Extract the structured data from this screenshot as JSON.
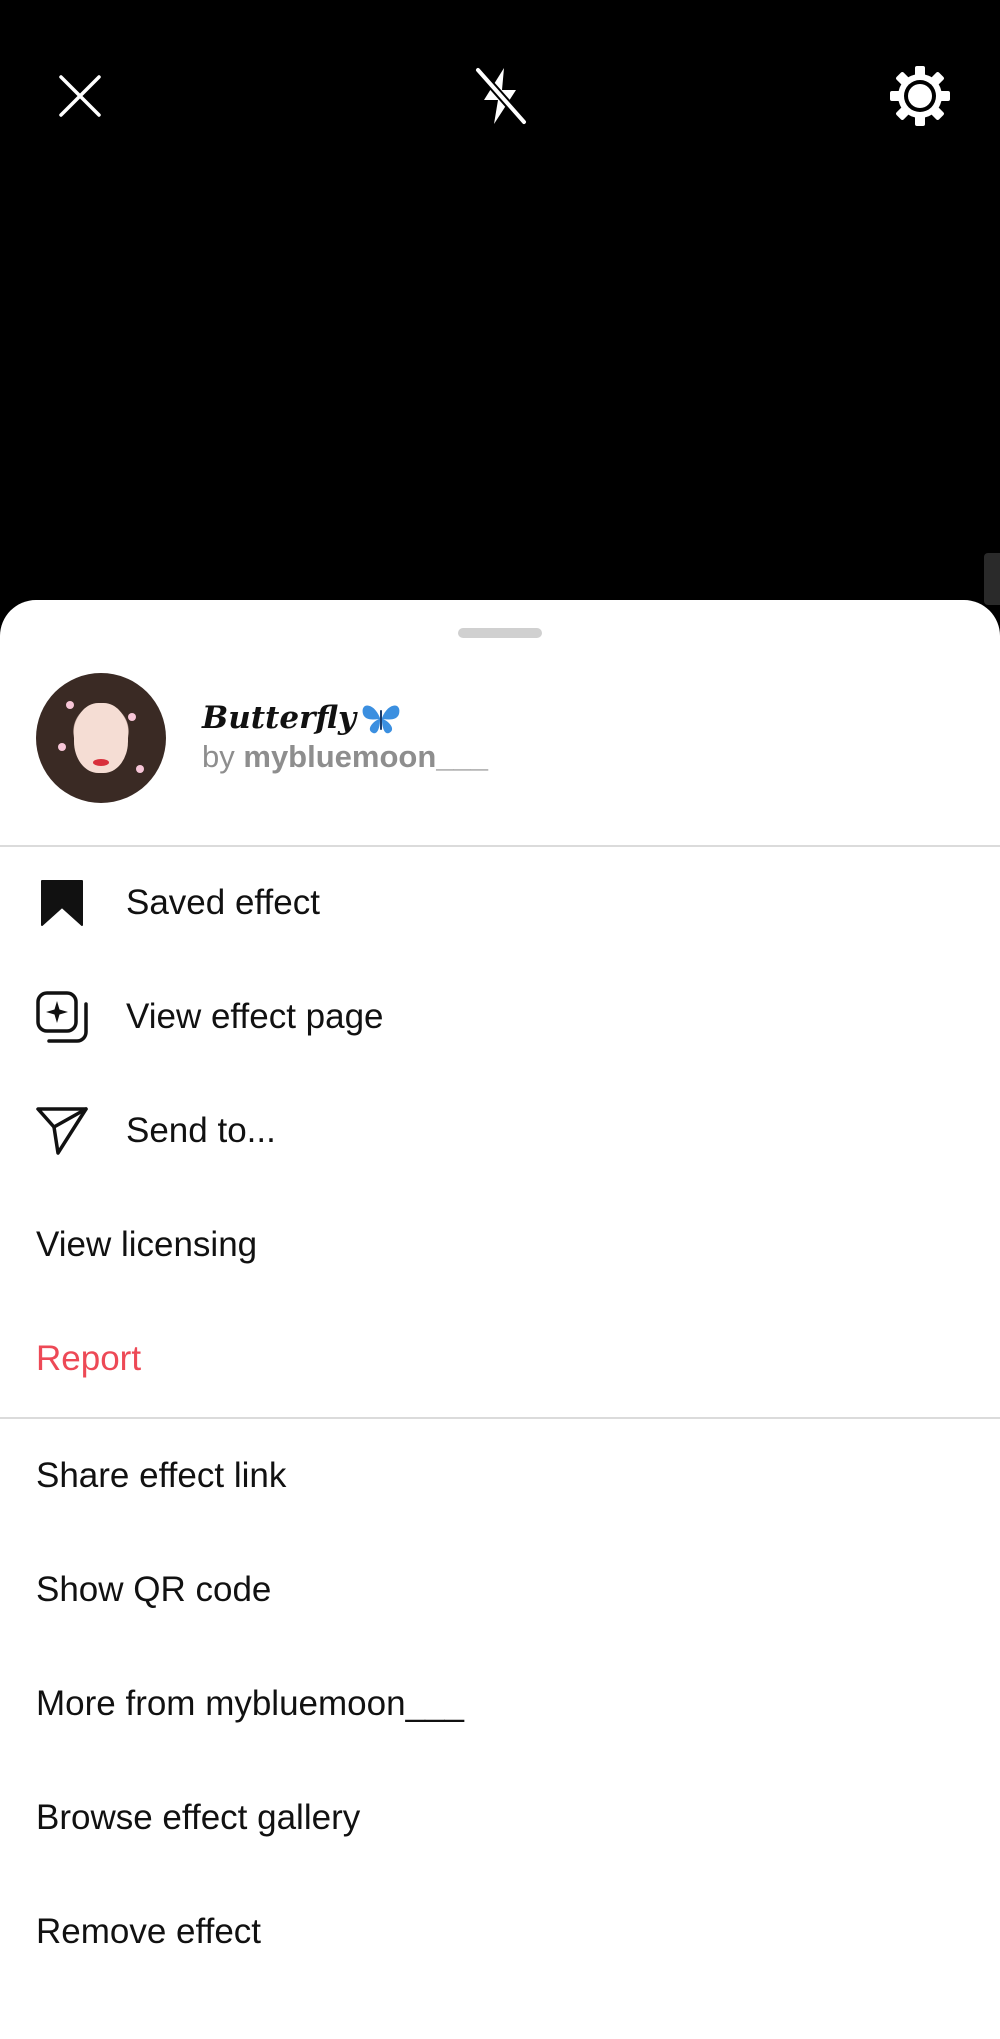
{
  "camera": {
    "close_icon": "close-icon",
    "flash_icon": "flash-off-icon",
    "settings_icon": "settings-icon"
  },
  "effect": {
    "title": "Butterfly",
    "title_emoji_icon": "butterfly-icon",
    "by_label": "by",
    "author": "mybluemoon___"
  },
  "menu_primary": [
    {
      "label": "Saved effect",
      "icon": "bookmark-filled-icon"
    },
    {
      "label": "View effect page",
      "icon": "effect-page-icon"
    },
    {
      "label": "Send to...",
      "icon": "paper-plane-icon"
    },
    {
      "label": "View licensing"
    },
    {
      "label": "Report",
      "color": "#ed4956"
    }
  ],
  "menu_secondary": [
    {
      "label": "Share effect link"
    },
    {
      "label": "Show QR code"
    },
    {
      "label": "More from mybluemoon___"
    },
    {
      "label": "Browse effect gallery"
    },
    {
      "label": "Remove effect"
    }
  ],
  "colors": {
    "danger": "#ed4956",
    "sheet_bg": "#ffffff",
    "camera_bg": "#000000",
    "muted_text": "#8e8e8e"
  }
}
